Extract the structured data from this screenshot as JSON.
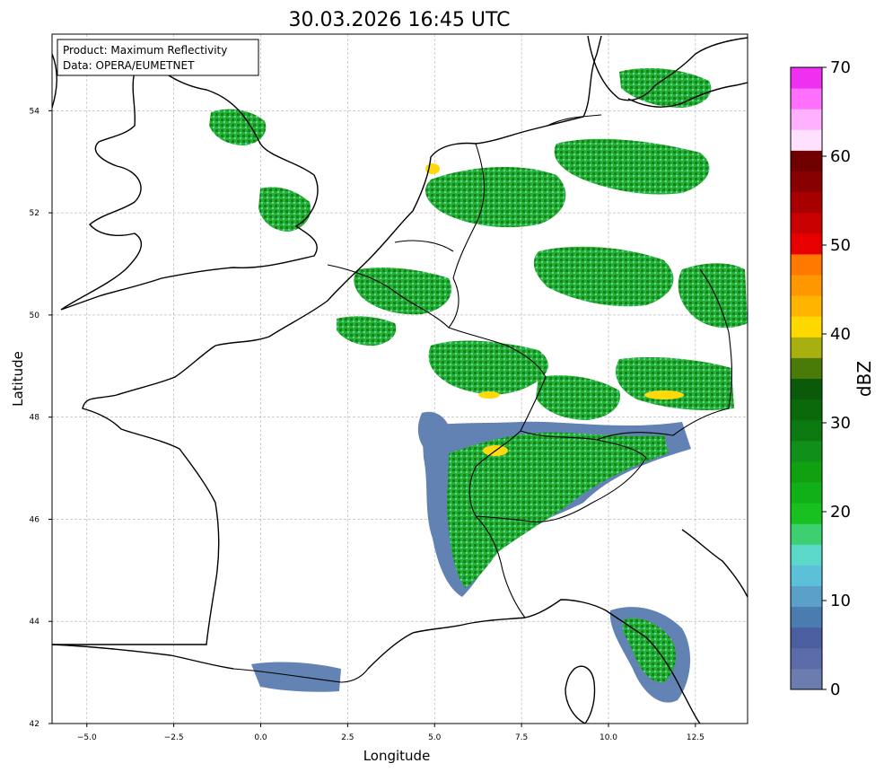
{
  "title": "30.03.2026 16:45 UTC",
  "info_box": {
    "line1": "Product: Maximum Reflectivity",
    "line2": "Data: OPERA/EUMETNET"
  },
  "axes": {
    "xlabel": "Longitude",
    "ylabel": "Latitude",
    "xlim": [
      -6,
      14
    ],
    "ylim": [
      42,
      55.5
    ],
    "xticks": [
      -5.0,
      -2.5,
      0.0,
      2.5,
      5.0,
      7.5,
      10.0,
      12.5
    ],
    "xtick_labels": [
      "−5.0",
      "−2.5",
      "0.0",
      "2.5",
      "5.0",
      "7.5",
      "10.0",
      "12.5"
    ],
    "yticks": [
      42,
      44,
      46,
      48,
      50,
      52,
      54
    ],
    "ytick_labels": [
      "42",
      "44",
      "46",
      "48",
      "50",
      "52",
      "54"
    ],
    "grid": true
  },
  "colorbar": {
    "label": "dBZ",
    "range": [
      0,
      70
    ],
    "ticks": [
      0,
      10,
      20,
      30,
      40,
      50,
      60,
      70
    ],
    "tick_labels": [
      "0",
      "10",
      "20",
      "30",
      "40",
      "50",
      "60",
      "70"
    ],
    "colors": [
      "#6b7caf",
      "#5b6ca8",
      "#4a5ea0",
      "#4a7cb0",
      "#5aa0c8",
      "#5cc0d8",
      "#5cd8c8",
      "#3cd070",
      "#18c020",
      "#10b018",
      "#10a010",
      "#10901a",
      "#0c7a10",
      "#0a6a0a",
      "#0a5a0a",
      "#4a7a08",
      "#a8b010",
      "#ffd800",
      "#ffb400",
      "#ff9800",
      "#ff7800",
      "#e80000",
      "#c80000",
      "#a80000",
      "#880000",
      "#700000",
      "#ffe0ff",
      "#ffb0ff",
      "#ff70ff",
      "#f030f0"
    ]
  },
  "colors": {
    "coast": "#000000",
    "grid": "#b0b0b0",
    "echo_light": "#5a7cb0",
    "echo_cyan": "#5cc8d0",
    "echo_green": "#18b020",
    "echo_dark": "#0c7a10",
    "echo_yellow": "#ffd800"
  },
  "echo_regions": [
    {
      "lon": 6.5,
      "lat": 46.3,
      "dbz": 20
    },
    {
      "lon": 9.5,
      "lat": 47.2,
      "dbz": 22
    },
    {
      "lon": 11.3,
      "lat": 43.7,
      "dbz": 25
    },
    {
      "lon": 6.8,
      "lat": 49.1,
      "dbz": 25
    },
    {
      "lon": 10.8,
      "lat": 48.6,
      "dbz": 28
    },
    {
      "lon": 8.0,
      "lat": 51.5,
      "dbz": 25
    },
    {
      "lon": 1.0,
      "lat": 42.8,
      "dbz": 10
    }
  ]
}
